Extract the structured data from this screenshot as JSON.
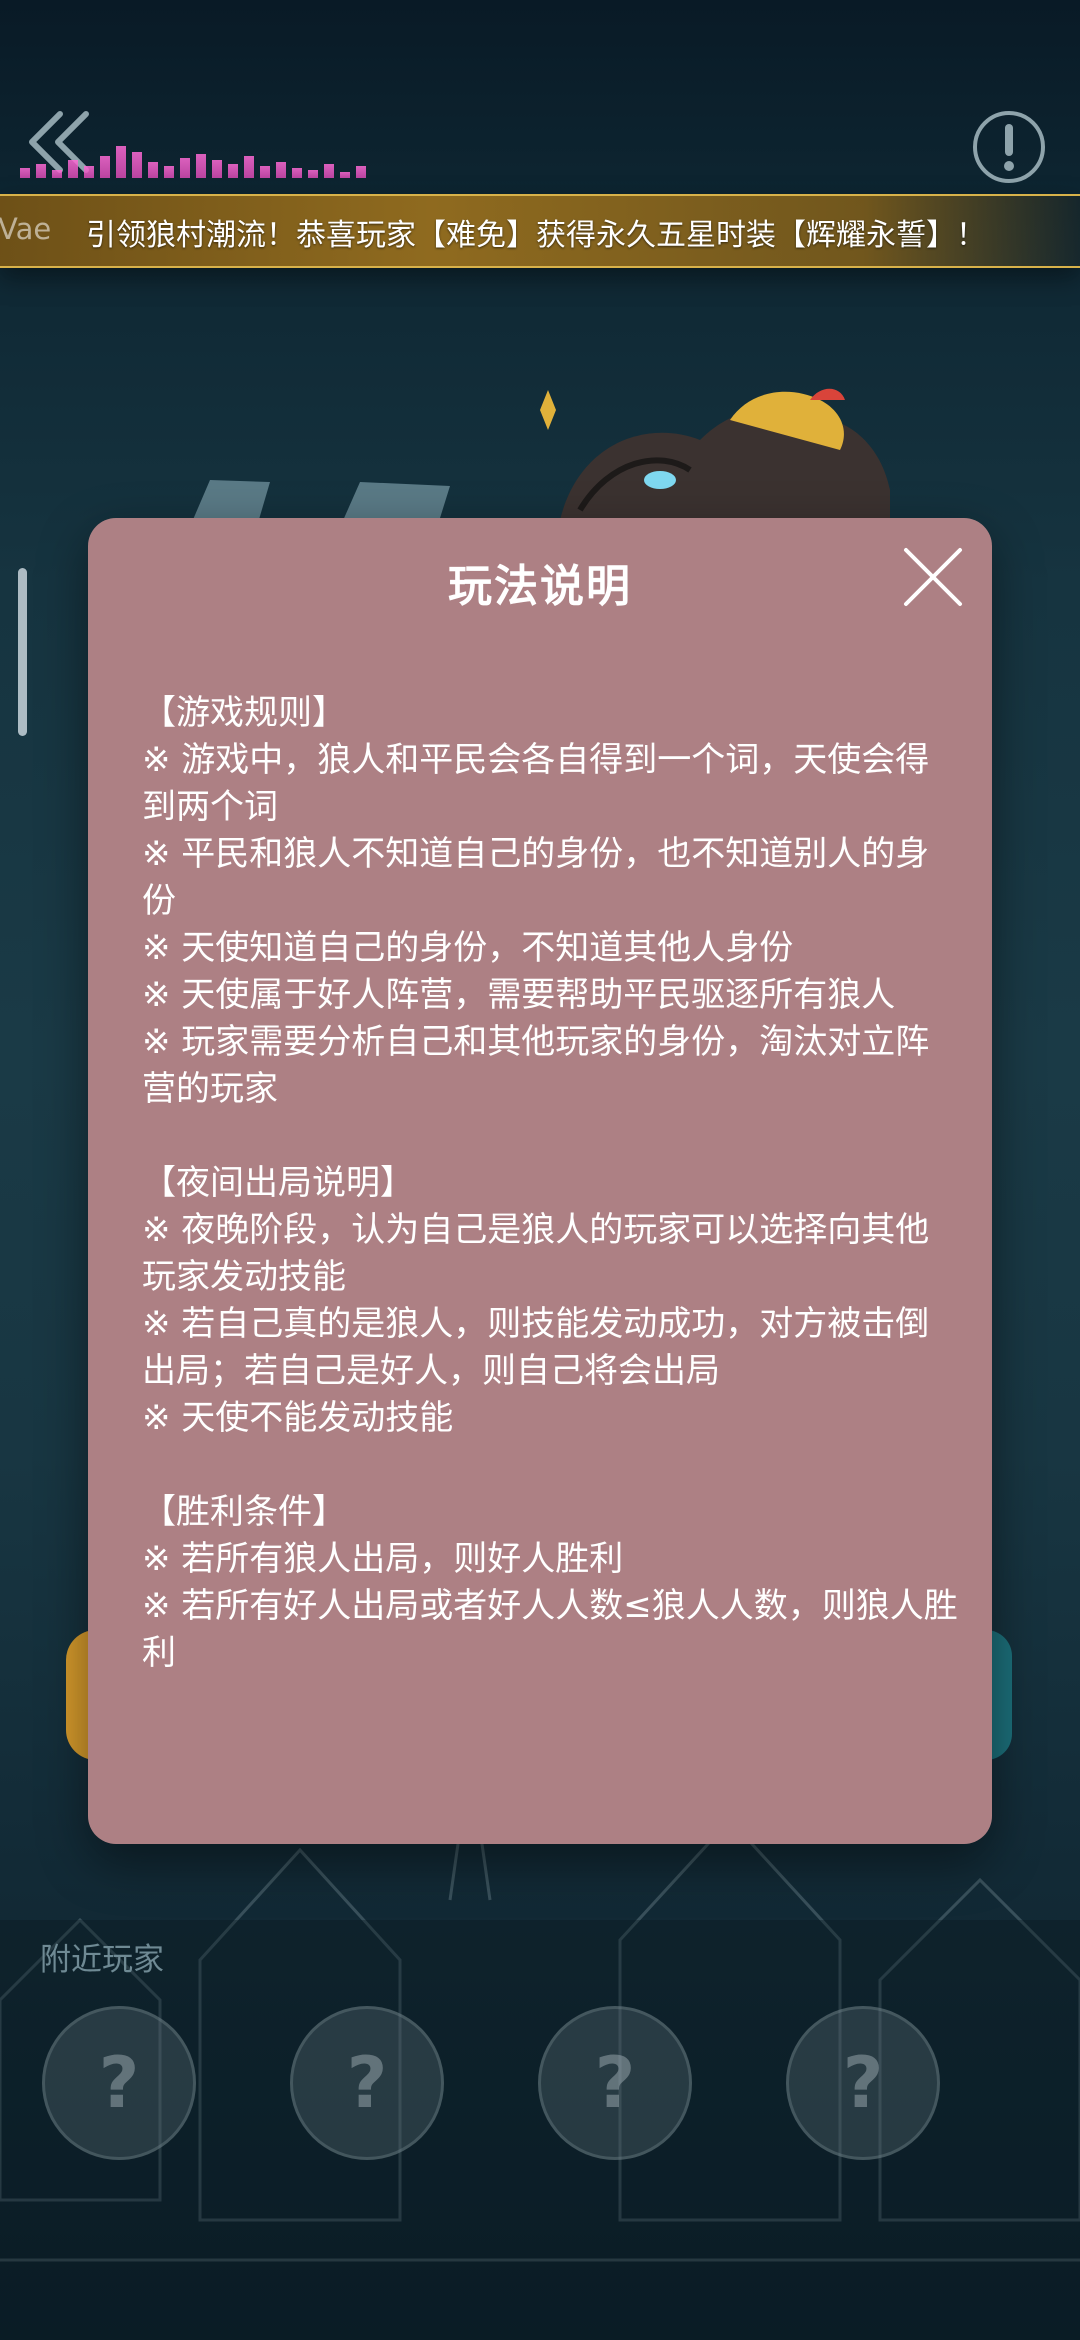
{
  "banner": {
    "ghost_text": "Vae",
    "text": "引领狼村潮流！恭喜玩家【难免】获得永久五星时装【辉耀永誓】！"
  },
  "modal": {
    "title": "玩法说明",
    "sections": [
      {
        "title": "【游戏规则】",
        "rules": [
          "※ 游戏中，狼人和平民会各自得到一个词，天使会得到两个词",
          "※ 平民和狼人不知道自己的身份，也不知道别人的身份",
          "※ 天使知道自己的身份，不知道其他人身份",
          "※ 天使属于好人阵营，需要帮助平民驱逐所有狼人",
          "※ 玩家需要分析自己和其他玩家的身份，淘汰对立阵营的玩家"
        ]
      },
      {
        "title": "【夜间出局说明】",
        "rules": [
          "※ 夜晚阶段，认为自己是狼人的玩家可以选择向其他玩家发动技能",
          "※ 若自己真的是狼人，则技能发动成功，对方被击倒出局；若自己是好人，则自己将会出局",
          "※ 天使不能发动技能"
        ]
      },
      {
        "title": "【胜利条件】",
        "rules": [
          "※ 若所有狼人出局，则好人胜利",
          "※ 若所有好人出局或者好人人数≤狼人人数，则狼人胜利"
        ]
      }
    ]
  },
  "nearby": {
    "title": "附近玩家",
    "avatars": [
      "?",
      "?",
      "?",
      "?"
    ]
  },
  "icons": {
    "back": "double-chevron-left-icon",
    "info": "exclamation-circle-icon",
    "close": "close-x-icon",
    "sound": "equalizer-icon"
  },
  "colors": {
    "modal_bg": "#ad8084",
    "banner_gold": "#d8b24a",
    "equalizer_pink": "#ff6bd6"
  }
}
